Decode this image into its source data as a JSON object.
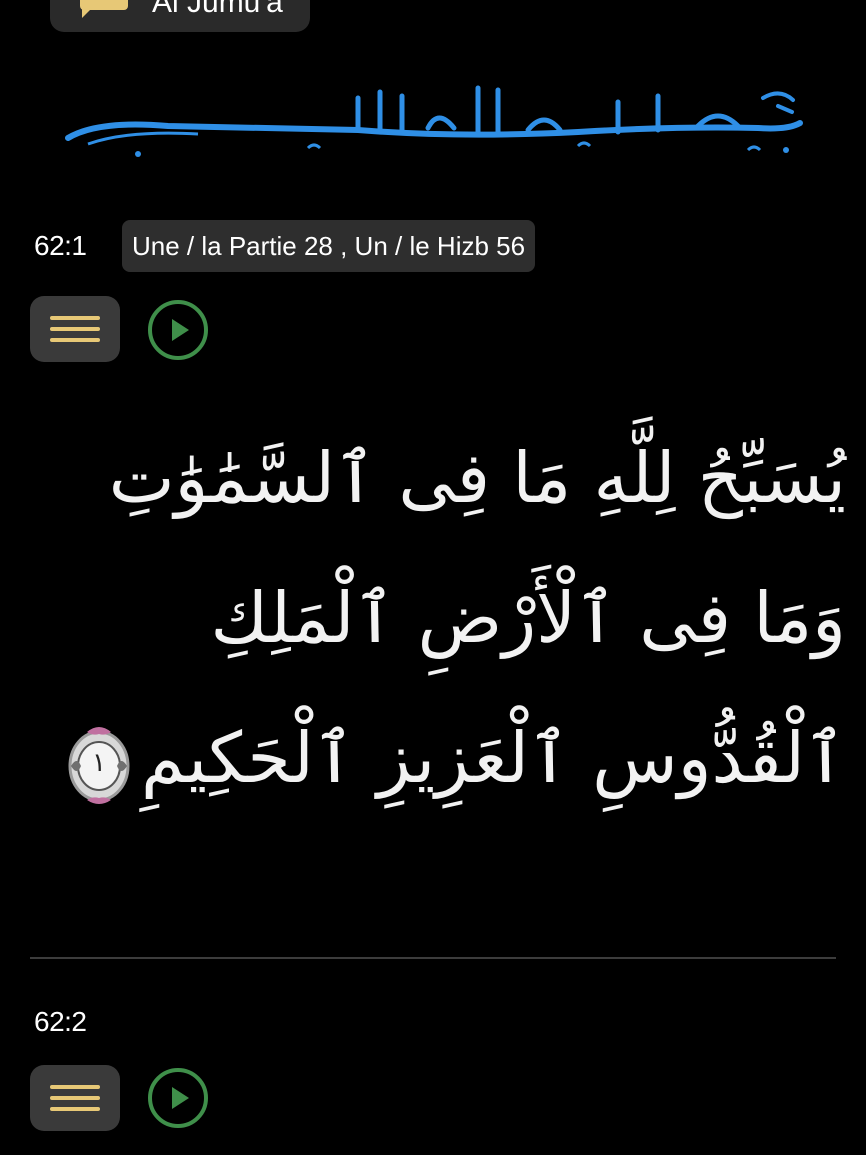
{
  "surah_chip": {
    "icon": "speech-bubble-icon",
    "label": "Al Jumu'a",
    "icon_color": "#e7c876"
  },
  "basmala": {
    "text": "بِسْمِ ٱللَّهِ ٱلرَّحْمَٰنِ ٱلرَّحِيمِ",
    "color": "#2f8fe6"
  },
  "verses": [
    {
      "number": "62:1",
      "meta": "Une / la Partie 28 , Un / le Hizb 56",
      "text": "يُسَبِّحُ لِلَّهِ مَا فِى ٱلسَّمَٰوَٰتِ وَمَا فِى ٱلْأَرْضِ ٱلْمَلِكِ ٱلْقُدُّوسِ ٱلْعَزِيزِ ٱلْحَكِيمِ",
      "ayah_marker": "١",
      "menu_icon": "hamburger-menu-icon",
      "play_icon": "play-icon"
    },
    {
      "number": "62:2",
      "menu_icon": "hamburger-menu-icon",
      "play_icon": "play-icon"
    }
  ],
  "colors": {
    "background": "#000000",
    "accent_gold": "#e7c876",
    "play_green": "#3f8f4a",
    "chip_bg": "#2e2e2e"
  }
}
